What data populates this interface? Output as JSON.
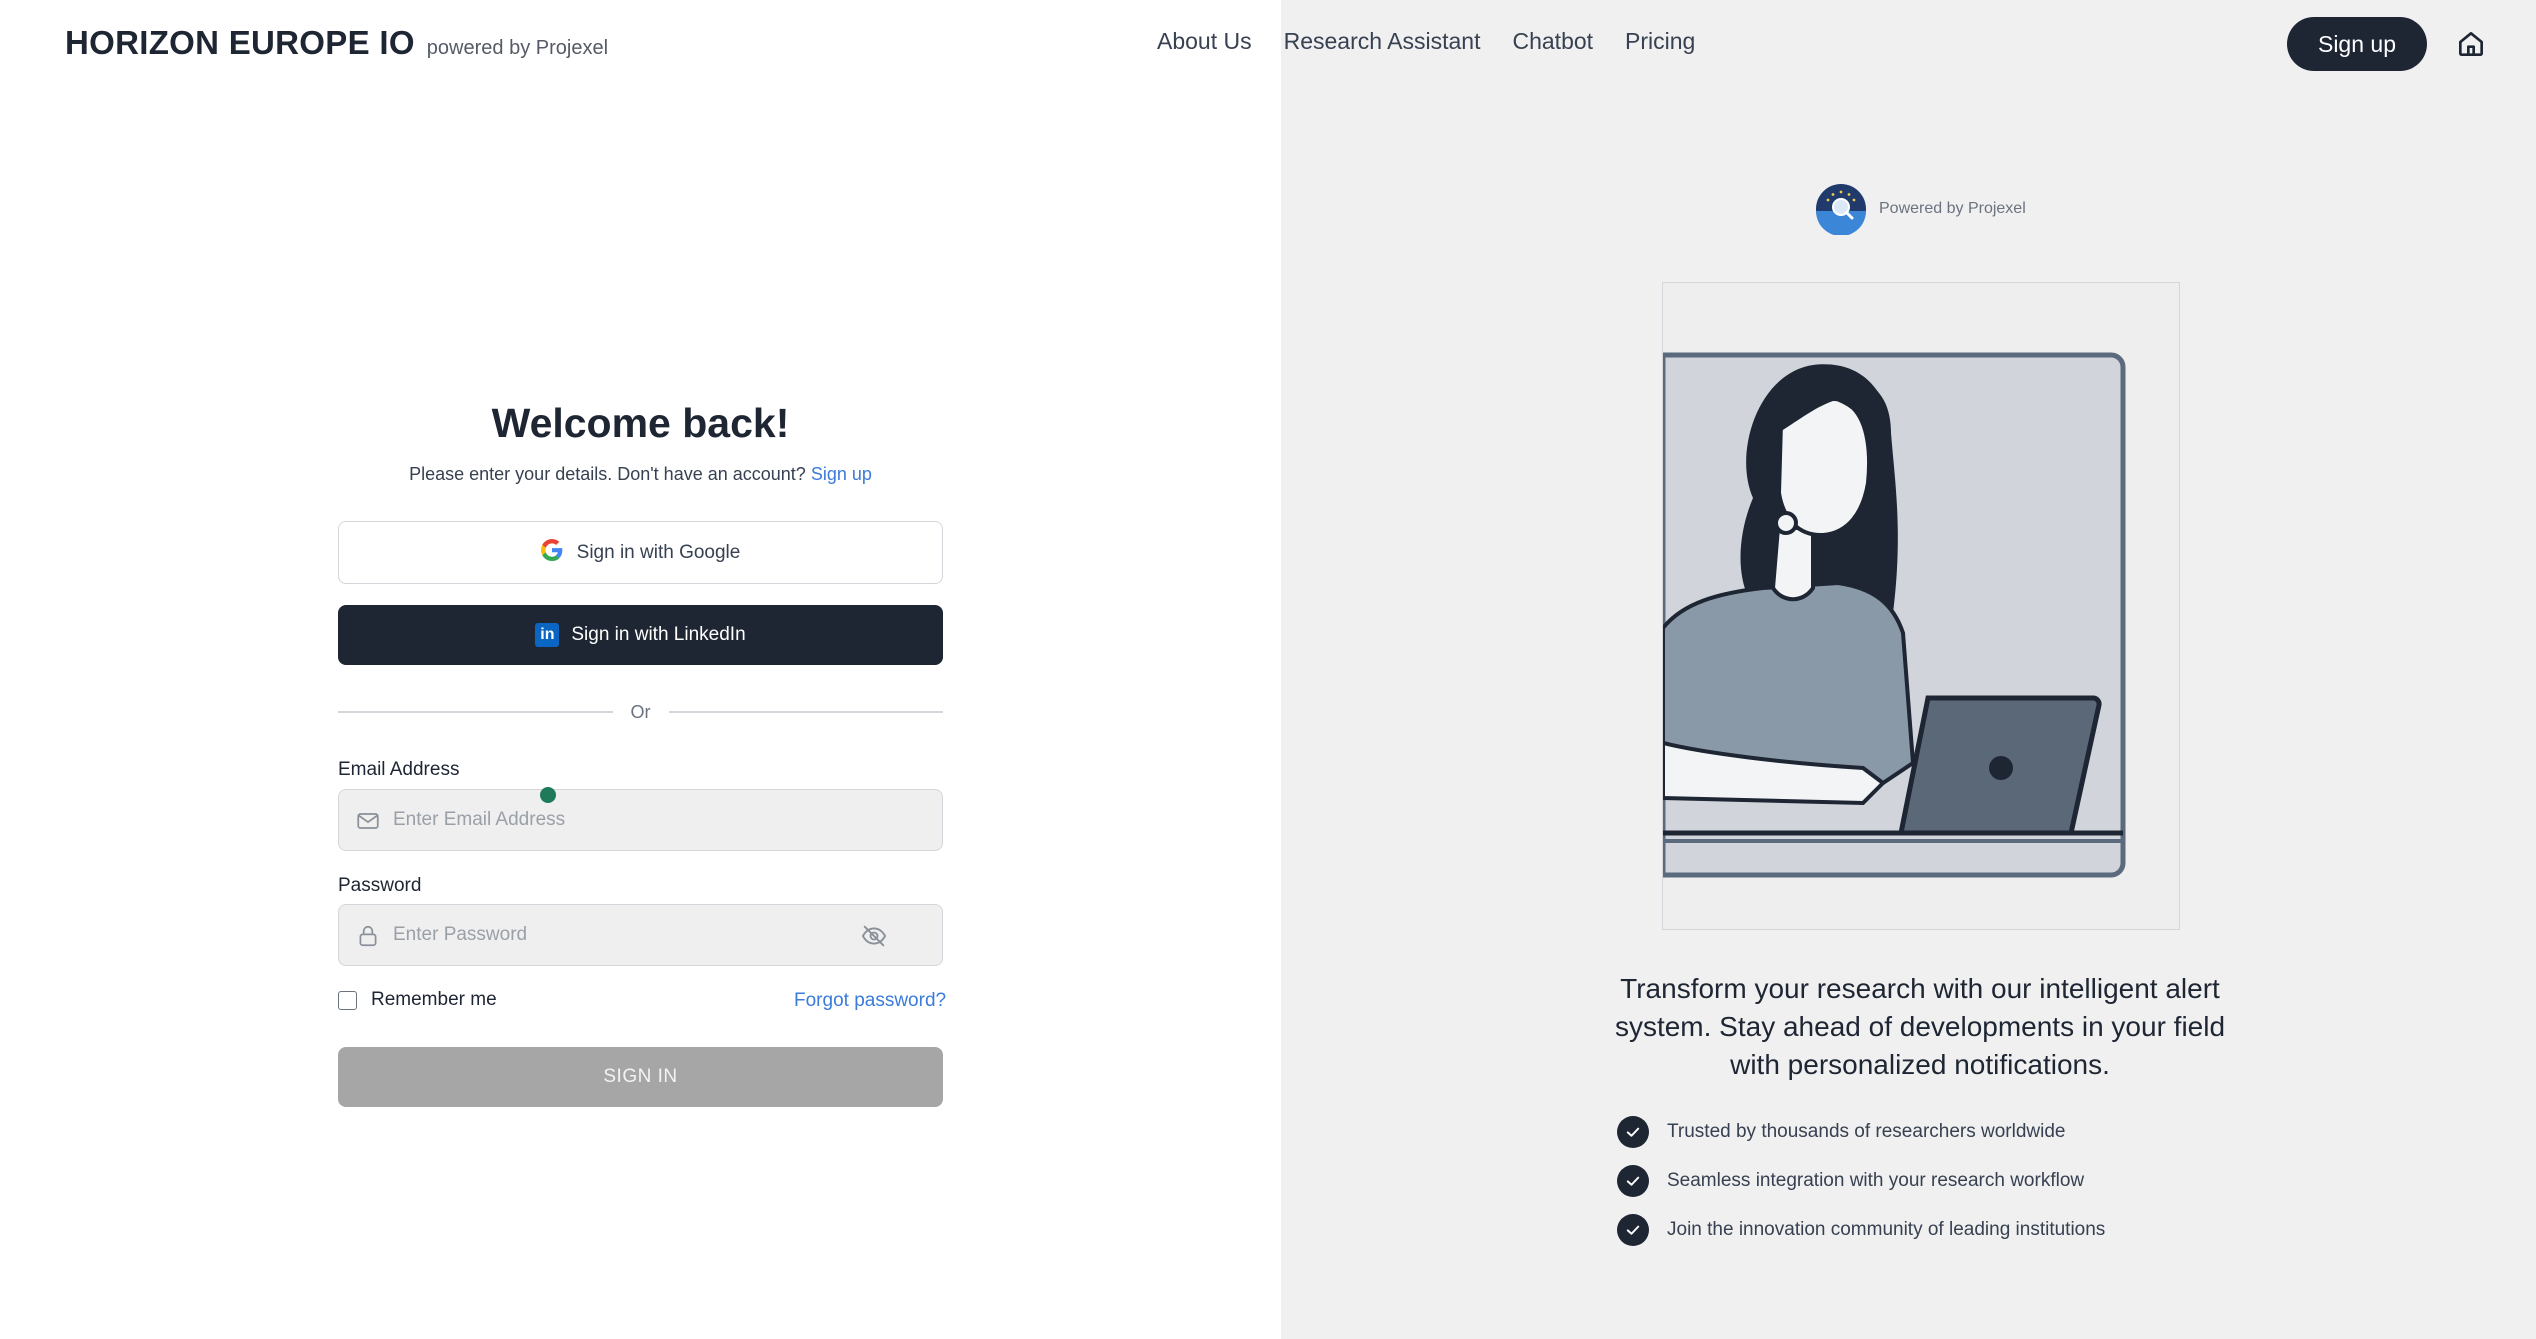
{
  "header": {
    "brand_title": "HORIZON EUROPE IO",
    "brand_sub": "powered by Projexel",
    "nav": [
      "About Us",
      "Research Assistant",
      "Chatbot",
      "Pricing"
    ],
    "signup_label": "Sign up",
    "home_icon": "home-icon"
  },
  "form": {
    "title": "Welcome back!",
    "subtitle_text": "Please enter your details. Don't have an account?",
    "subtitle_link": "Sign up",
    "google_label": "Sign in with Google",
    "linkedin_label": "Sign in with LinkedIn",
    "divider_text": "Or",
    "email_label": "Email Address",
    "email_placeholder": "Enter Email Address",
    "email_value": "",
    "password_label": "Password",
    "password_placeholder": "Enter Password",
    "password_value": "",
    "remember_label": "Remember me",
    "remember_checked": false,
    "forgot_label": "Forgot password?",
    "signin_label": "SIGN IN"
  },
  "aside": {
    "powered_label": "Powered by Projexel",
    "tagline": "Transform your research with our intelligent alert system. Stay ahead of developments in your field with personalized notifications.",
    "features": [
      "Trusted by thousands of researchers worldwide",
      "Seamless integration with your research workflow",
      "Join the innovation community of leading institutions"
    ]
  },
  "colors": {
    "primary": "#1e2533",
    "link": "#3b7bd9",
    "right_panel_bg": "#f0f0f0",
    "disabled_button": "#a6a6a6",
    "linkedin_blue": "#0a66c2"
  }
}
